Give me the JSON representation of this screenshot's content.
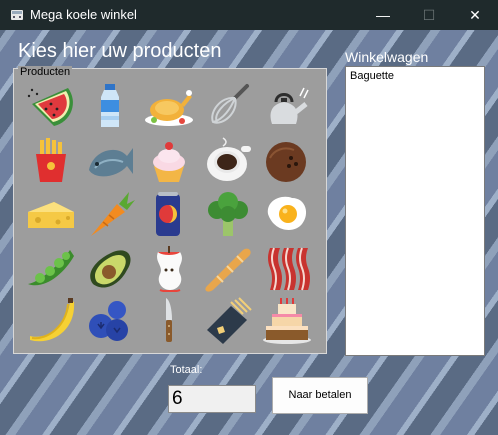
{
  "window": {
    "title": "Mega koele winkel",
    "minimize_glyph": "—",
    "maximize_glyph": "☐",
    "close_glyph": "✕"
  },
  "heading": "Kies hier uw producten",
  "products_group": {
    "legend": "Producten",
    "items": [
      {
        "icon": "watermelon-icon"
      },
      {
        "icon": "water-bottle-icon"
      },
      {
        "icon": "roast-chicken-icon"
      },
      {
        "icon": "whisk-icon"
      },
      {
        "icon": "kettle-icon"
      },
      {
        "icon": "french-fries-icon"
      },
      {
        "icon": "fish-icon"
      },
      {
        "icon": "cupcake-icon"
      },
      {
        "icon": "coffee-cup-icon"
      },
      {
        "icon": "coconut-icon"
      },
      {
        "icon": "cheese-icon"
      },
      {
        "icon": "carrot-icon"
      },
      {
        "icon": "soda-can-icon"
      },
      {
        "icon": "broccoli-icon"
      },
      {
        "icon": "fried-egg-icon"
      },
      {
        "icon": "peas-icon"
      },
      {
        "icon": "avocado-icon"
      },
      {
        "icon": "apple-core-icon"
      },
      {
        "icon": "baguette-icon"
      },
      {
        "icon": "bacon-icon"
      },
      {
        "icon": "banana-icon"
      },
      {
        "icon": "blueberries-icon"
      },
      {
        "icon": "knife-icon"
      },
      {
        "icon": "pasta-icon"
      },
      {
        "icon": "cake-icon"
      }
    ]
  },
  "cart": {
    "label": "Winkelwagen",
    "items": [
      "Baguette"
    ]
  },
  "total": {
    "label": "Totaal:",
    "value": "6"
  },
  "pay_button": {
    "label": "Naar betalen"
  },
  "colors": {
    "titlebar": "#1f2a2c",
    "group_background": "#9d9d9d",
    "window_background": "#6c7c93"
  }
}
